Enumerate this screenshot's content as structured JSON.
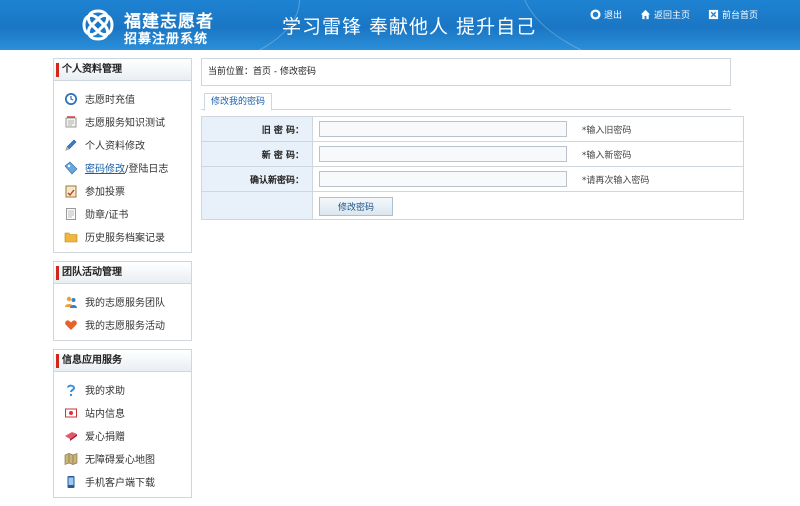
{
  "header": {
    "logo_line1": "福建志愿者",
    "logo_line2": "招募注册系统",
    "slogan": "学习雷锋  奉献他人  提升自己",
    "links": [
      {
        "label": "退出",
        "icon": "logout-icon"
      },
      {
        "label": "返回主页",
        "icon": "home-icon"
      },
      {
        "label": "前台首页",
        "icon": "front-page-icon"
      }
    ]
  },
  "sidebar": {
    "sections": [
      {
        "title": "个人资料管理",
        "items": [
          {
            "label": "志愿时充值",
            "icon": "clock-icon"
          },
          {
            "label": "志愿服务知识测试",
            "icon": "notepad-icon"
          },
          {
            "label": "个人资料修改",
            "icon": "pencil-icon"
          },
          {
            "label_link": "密码修改",
            "label_rest": "/登陆日志",
            "icon": "tag-icon"
          },
          {
            "label": "参加投票",
            "icon": "vote-icon"
          },
          {
            "label": "勋章/证书",
            "icon": "document-icon"
          },
          {
            "label": "历史服务档案记录",
            "icon": "folder-icon"
          }
        ]
      },
      {
        "title": "团队活动管理",
        "items": [
          {
            "label": "我的志愿服务团队",
            "icon": "team-icon"
          },
          {
            "label": "我的志愿服务活动",
            "icon": "heart-icon"
          }
        ]
      },
      {
        "title": "信息应用服务",
        "items": [
          {
            "label": "我的求助",
            "icon": "help-icon"
          },
          {
            "label": "站内信息",
            "icon": "message-icon"
          },
          {
            "label": "爱心捐赠",
            "icon": "donation-icon"
          },
          {
            "label": "无障碍爱心地图",
            "icon": "map-icon"
          },
          {
            "label": "手机客户端下载",
            "icon": "mobile-icon"
          }
        ]
      }
    ]
  },
  "main": {
    "breadcrumb": "当前位置：首页 - 修改密码",
    "tab_label": "修改我的密码",
    "fields": [
      {
        "label": "旧 密 码：",
        "value": "",
        "hint": "*输入旧密码"
      },
      {
        "label": "新 密 码：",
        "value": "",
        "hint": "*输入新密码"
      },
      {
        "label": "确认新密码：",
        "value": "",
        "hint": "*请再次输入密码"
      }
    ],
    "submit_label": "修改密码"
  },
  "colors": {
    "header_blue": "#1e83d2",
    "accent_red": "#d0261c",
    "label_cell_bg": "#e8f1fa",
    "border": "#cfd6dd"
  }
}
